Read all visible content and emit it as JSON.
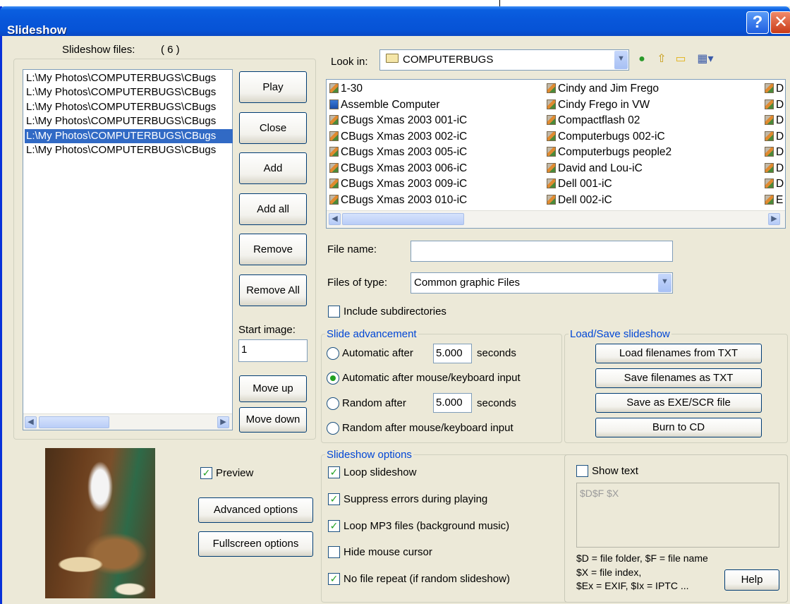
{
  "window": {
    "title": "Slideshow",
    "help_glyph": "?",
    "close_glyph": "✕"
  },
  "left": {
    "files_label": "Slideshow files:",
    "files_count": "( 6 )",
    "files": [
      "L:\\My Photos\\COMPUTERBUGS\\CBugs",
      "L:\\My Photos\\COMPUTERBUGS\\CBugs",
      "L:\\My Photos\\COMPUTERBUGS\\CBugs",
      "L:\\My Photos\\COMPUTERBUGS\\CBugs",
      "L:\\My Photos\\COMPUTERBUGS\\CBugs",
      "L:\\My Photos\\COMPUTERBUGS\\CBugs"
    ],
    "selected_index": 4,
    "buttons": {
      "play": "Play",
      "close": "Close",
      "add": "Add",
      "add_all": "Add all",
      "remove": "Remove",
      "remove_all": "Remove All",
      "move_up": "Move up",
      "move_down": "Move down"
    },
    "start_image_label": "Start image:",
    "start_image_value": "1",
    "preview_label": "Preview",
    "preview_checked": true,
    "advanced_options": "Advanced options",
    "fullscreen_options": "Fullscreen options"
  },
  "browser": {
    "look_in_label": "Look in:",
    "look_in_value": "COMPUTERBUGS",
    "columns": [
      [
        {
          "name": "1-30",
          "type": "image"
        },
        {
          "name": "Assemble Computer",
          "type": "doc"
        },
        {
          "name": "CBugs Xmas 2003 001-iC",
          "type": "image"
        },
        {
          "name": "CBugs Xmas 2003 002-iC",
          "type": "image"
        },
        {
          "name": "CBugs Xmas 2003 005-iC",
          "type": "image"
        },
        {
          "name": "CBugs Xmas 2003 006-iC",
          "type": "image"
        },
        {
          "name": "CBugs Xmas 2003 009-iC",
          "type": "image"
        },
        {
          "name": "CBugs Xmas 2003 010-iC",
          "type": "image"
        }
      ],
      [
        {
          "name": "Cindy and Jim Frego",
          "type": "image"
        },
        {
          "name": "Cindy Frego in VW",
          "type": "image"
        },
        {
          "name": "Compactflash 02",
          "type": "image"
        },
        {
          "name": "Computerbugs 002-iC",
          "type": "image"
        },
        {
          "name": "Computerbugs people2",
          "type": "image"
        },
        {
          "name": "David and Lou-iC",
          "type": "image"
        },
        {
          "name": "Dell 001-iC",
          "type": "image"
        },
        {
          "name": "Dell 002-iC",
          "type": "image"
        }
      ],
      [
        {
          "name": "D",
          "type": "image"
        },
        {
          "name": "D",
          "type": "image"
        },
        {
          "name": "D",
          "type": "image"
        },
        {
          "name": "D",
          "type": "image"
        },
        {
          "name": "D",
          "type": "image"
        },
        {
          "name": "D",
          "type": "image"
        },
        {
          "name": "D",
          "type": "image"
        },
        {
          "name": "E",
          "type": "image"
        }
      ]
    ],
    "file_name_label": "File name:",
    "file_name_value": "",
    "files_of_type_label": "Files of type:",
    "files_of_type_value": "Common graphic Files",
    "include_subdirs_label": "Include subdirectories",
    "include_subdirs_checked": false
  },
  "slide_advancement": {
    "title": "Slide advancement",
    "auto_after_label": "Automatic after",
    "auto_after_value": "5.000",
    "seconds": "seconds",
    "auto_input_label": "Automatic after mouse/keyboard input",
    "random_after_label": "Random  after",
    "random_after_value": "5.000",
    "random_input_label": "Random  after mouse/keyboard input",
    "selected": "auto_input"
  },
  "load_save": {
    "title": "Load/Save slideshow",
    "load_txt": "Load filenames from TXT",
    "save_txt": "Save filenames as TXT",
    "save_exe": "Save as  EXE/SCR file",
    "burn_cd": "Burn to CD"
  },
  "slideshow_options": {
    "title": "Slideshow options",
    "loop": {
      "label": "Loop slideshow",
      "checked": true
    },
    "suppress": {
      "label": "Suppress errors during playing",
      "checked": true
    },
    "loop_mp3": {
      "label": "Loop MP3 files (background music)",
      "checked": true
    },
    "hide_cursor": {
      "label": "Hide mouse cursor",
      "checked": false
    },
    "no_repeat": {
      "label": "No file repeat (if random slideshow)",
      "checked": true
    }
  },
  "show_text": {
    "label": "Show text",
    "checked": false,
    "template": "$D$F $X",
    "help_line1": "$D = file folder, $F = file name",
    "help_line2": "$X = file index,",
    "help_line3": "$Ex = EXIF, $Ix = IPTC ...",
    "help_button": "Help"
  },
  "colors": {
    "accent": "#0046d5",
    "selection": "#316ac5",
    "dialog_bg": "#ece9d8"
  }
}
